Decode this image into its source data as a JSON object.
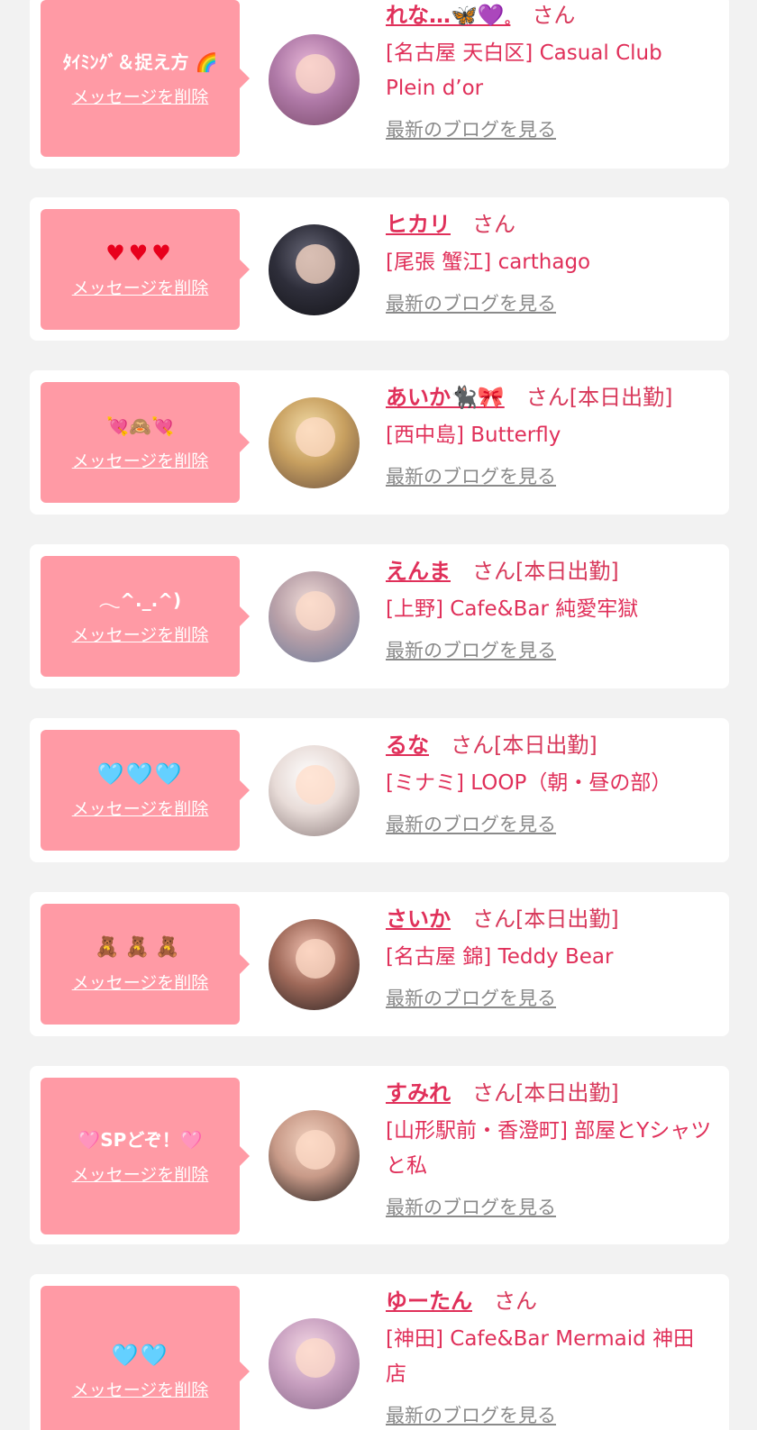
{
  "delete_label": "メッセージを削除",
  "blog_label": "最新のブログを見る",
  "colors": {
    "page_bg": "#f2f2f2",
    "bubble": "#ff9aa5",
    "name": "#e0305a",
    "link_gray": "#8a8a8a"
  },
  "cards": [
    {
      "message": "ﾀｲﾐﾝｸﾞ＆捉え方 🌈",
      "message_style": "plain",
      "name": "れな…🦋💜𓈒",
      "suffix": "さん",
      "shop": "[名古屋 天白区] Casual Club Plein d’or",
      "avatar_colors": [
        "#e8b8d8",
        "#b07aa8",
        "#7a4a6a"
      ]
    },
    {
      "message": "♥♥♥",
      "message_style": "hearts",
      "name": "ヒカリ",
      "suffix": "さん",
      "shop": "[尾張 蟹江] carthago",
      "avatar_colors": [
        "#6a6a7a",
        "#2e2e3a",
        "#141418"
      ]
    },
    {
      "message": "💘🙈💘",
      "message_style": "plain",
      "name": "あいか🐈‍⬛🎀",
      "suffix": "さん[本日出勤]",
      "shop": "[西中島] Butterfly",
      "avatar_colors": [
        "#f2dca8",
        "#c8a060",
        "#6a5040"
      ]
    },
    {
      "message": "𓂃^._.^)",
      "message_style": "plain",
      "name": "えんま",
      "suffix": "さん[本日出勤]",
      "shop": "[上野] Cafe&Bar 純愛牢獄",
      "avatar_colors": [
        "#f0dcd8",
        "#b8a0a8",
        "#6a7a9a"
      ]
    },
    {
      "message": "🩵🩵🩵",
      "message_style": "blue",
      "name": "るな",
      "suffix": "さん[本日出勤]",
      "shop": "[ミナミ] LOOP（朝・昼の部）",
      "avatar_colors": [
        "#ffffff",
        "#e8dcd8",
        "#8a7a7a"
      ]
    },
    {
      "message": "🧸🧸🧸",
      "message_style": "bears",
      "name": "さいか",
      "suffix": "さん[本日出勤]",
      "shop": "[名古屋 錦] Teddy Bear",
      "avatar_colors": [
        "#f0c0b0",
        "#a06a5a",
        "#2a2222"
      ]
    },
    {
      "message": "🩷SPどぞ！🩷",
      "message_style": "plain",
      "name": "すみれ",
      "suffix": "さん[本日出勤]",
      "shop": "[山形駅前・香澄町] 部屋とYシャツと私",
      "avatar_colors": [
        "#f2d2c0",
        "#c89a88",
        "#1e1a1a"
      ]
    },
    {
      "message": "🩵🩵",
      "message_style": "blue",
      "name": "ゆーたん",
      "suffix": "さん",
      "shop": "[神田] Cafe&Bar Mermaid 神田店",
      "avatar_colors": [
        "#f4d8e4",
        "#c8a0c0",
        "#8a6a8a"
      ]
    }
  ]
}
